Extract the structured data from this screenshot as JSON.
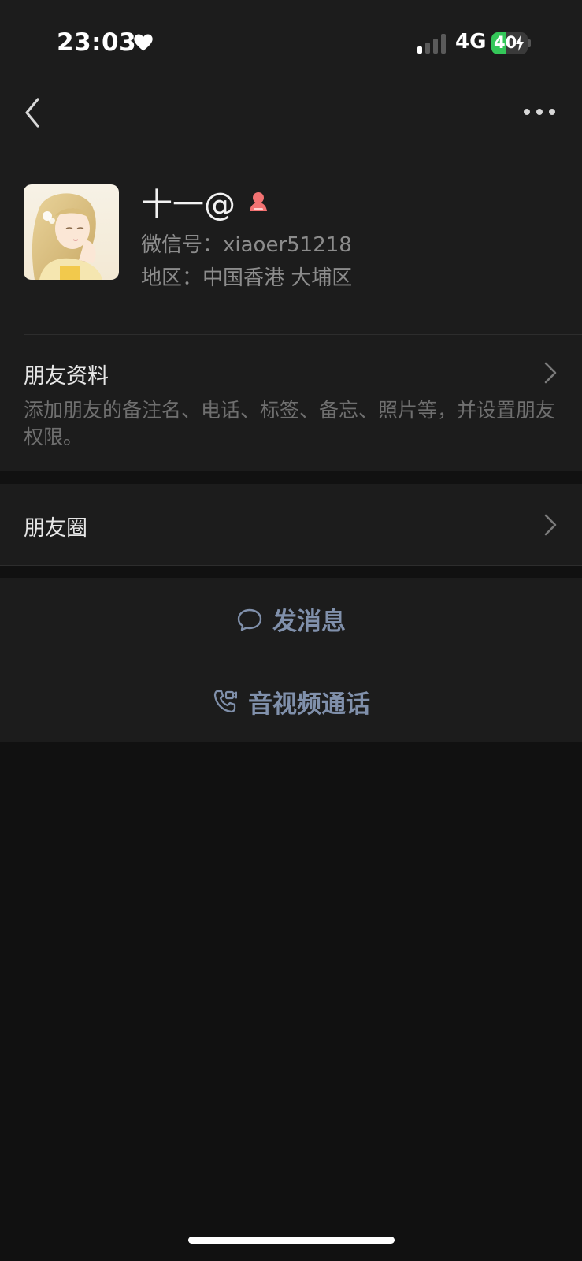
{
  "status_bar": {
    "time": "23:03",
    "network": "4G",
    "battery_level": "40",
    "battery_percent": 40,
    "battery_color": "#34c759",
    "signal_bars_active": 1,
    "signal_bars_total": 4,
    "heart_icon": "heart-icon"
  },
  "nav": {
    "back_icon": "chevron-left-icon",
    "more_icon": "more-dots-icon"
  },
  "profile": {
    "name": "十一@",
    "gender_icon": "female-icon",
    "gender_color": "#f27272",
    "wechat_id": "微信号：xiaoer51218",
    "region": "地区：中国香港 大埔区",
    "avatar": "avatar-illustration"
  },
  "menu": {
    "friend_profile_title": "朋友资料",
    "friend_profile_desc": "添加朋友的备注名、电话、标签、备忘、照片等，并设置朋友权限。",
    "moments_title": "朋友圈",
    "chevron_icon": "chevron-right-icon"
  },
  "actions": {
    "message_label": "发消息",
    "message_icon": "chat-bubble-icon",
    "call_label": "音视频通话",
    "call_icon": "phone-video-icon",
    "accent_color": "#8090ab"
  }
}
